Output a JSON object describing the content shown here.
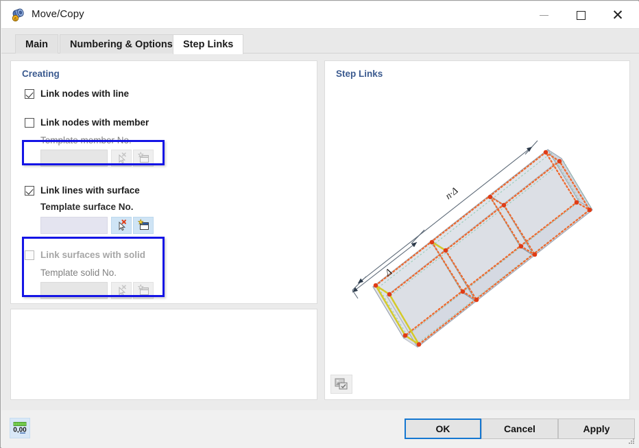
{
  "window": {
    "title": "Move/Copy",
    "icon": "move-copy-icon",
    "minimize": "minimize-icon",
    "maximize": "maximize-icon",
    "close": "close-icon"
  },
  "tabs": [
    {
      "label": "Main",
      "active": false
    },
    {
      "label": "Numbering & Options",
      "active": false
    },
    {
      "label": "Step Links",
      "active": true
    }
  ],
  "creating": {
    "title": "Creating",
    "options": [
      {
        "label": "Link nodes with line",
        "checked": true,
        "enabled": true,
        "highlighted": true,
        "sub_label": null,
        "field_value": "",
        "buttons": []
      },
      {
        "label": "Link nodes with member",
        "checked": false,
        "enabled": true,
        "highlighted": false,
        "sub_label": "Template member No.",
        "field_value": "",
        "buttons": [
          "pick-deselect-icon",
          "new-template-icon"
        ]
      },
      {
        "label": "Link lines with surface",
        "checked": true,
        "enabled": true,
        "highlighted": true,
        "sub_label": "Template surface No.",
        "field_value": "",
        "buttons": [
          "pick-deselect-icon",
          "new-template-icon"
        ]
      },
      {
        "label": "Link surfaces with solid",
        "checked": false,
        "enabled": false,
        "highlighted": false,
        "sub_label": "Template solid No.",
        "field_value": "",
        "buttons": [
          "pick-deselect-icon",
          "new-template-icon"
        ]
      }
    ]
  },
  "preview": {
    "title": "Step Links",
    "image_button": "preview-image-icon",
    "diagram": {
      "description": "Isometric wireframe box subdivided into three bays with copied step links",
      "dimension_total": "n·Δ",
      "dimension_step": "Δ",
      "colors": {
        "node": "#e03c16",
        "copy_line": "#f2703a",
        "surface": "#d9dce2",
        "original_edge": "#c9c22b",
        "top_edge": "#a8cdea",
        "guide": "#7fc6a8"
      }
    }
  },
  "footer": {
    "units_button": "units-0-00-icon",
    "ok": "OK",
    "cancel": "Cancel",
    "apply": "Apply",
    "resize_grip": "resize-grip-icon"
  },
  "theme": {
    "accent": "#1477d1",
    "panel_title": "#3b5a8f",
    "annotation": "#1414e6",
    "window_bg": "#f0f0f0",
    "content_bg": "#ebebeb"
  }
}
